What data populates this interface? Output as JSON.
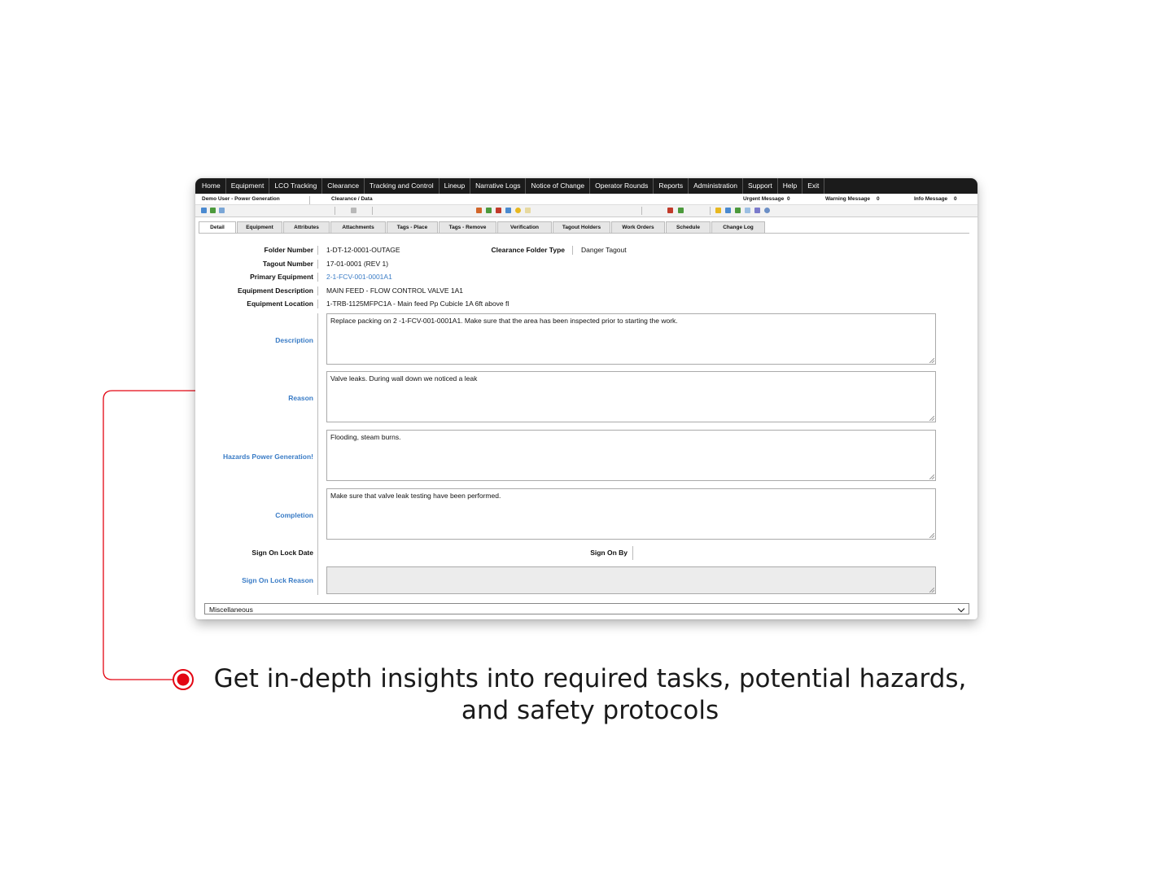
{
  "menu": [
    "Home",
    "Equipment",
    "LCO Tracking",
    "Clearance",
    "Tracking and Control",
    "Lineup",
    "Narrative Logs",
    "Notice of Change",
    "Operator Rounds",
    "Reports",
    "Administration",
    "Support",
    "Help",
    "Exit"
  ],
  "infobar": {
    "user": "Demo User - Power Generation",
    "path": "Clearance / Data",
    "urgent_label": "Urgent Message",
    "urgent_count": "0",
    "warning_label": "Warning Message",
    "warning_count": "0",
    "info_label": "Info Message",
    "info_count": "0"
  },
  "tabs": [
    "Detail",
    "Equipment",
    "Attributes",
    "Attachments",
    "Tags - Place",
    "Tags - Remove",
    "Verification",
    "Tagout Holders",
    "Work Orders",
    "Schedule",
    "Change Log"
  ],
  "fields": {
    "folder_number_label": "Folder Number",
    "folder_number": "1-DT-12-0001-OUTAGE",
    "folder_type_label": "Clearance Folder Type",
    "folder_type": "Danger Tagout",
    "tagout_number_label": "Tagout Number",
    "tagout_number": "17-01-0001 (REV 1)",
    "primary_equipment_label": "Primary Equipment",
    "primary_equipment": "2-1-FCV-001-0001A1",
    "equipment_description_label": "Equipment Description",
    "equipment_description": "MAIN FEED - FLOW CONTROL VALVE 1A1",
    "equipment_location_label": "Equipment Location",
    "equipment_location": "1-TRB-1125MFPC1A - Main feed Pp Cubicle 1A 6ft above fl",
    "description_label": "Description",
    "description": "Replace packing on 2 -1-FCV-001-0001A1. Make sure that the area has been inspected prior to starting the work.",
    "reason_label": "Reason",
    "reason": "Valve leaks. During wall down we noticed a leak",
    "hazards_label": "Hazards Power Generation!",
    "hazards": "Flooding, steam burns.",
    "completion_label": "Completion",
    "completion": "Make sure that valve leak testing have been performed.",
    "sign_on_lock_date_label": "Sign On Lock Date",
    "sign_on_by_label": "Sign On By",
    "sign_on_lock_reason_label": "Sign On Lock Reason"
  },
  "dropdown": {
    "selected": "Miscellaneous"
  },
  "caption": {
    "line1": "Get in-depth insights into required tasks, potential hazards,",
    "line2": "and safety protocols"
  },
  "colors": {
    "accent": "#e30613",
    "link": "#3a7cc6",
    "menubar": "#1b1b1b"
  }
}
